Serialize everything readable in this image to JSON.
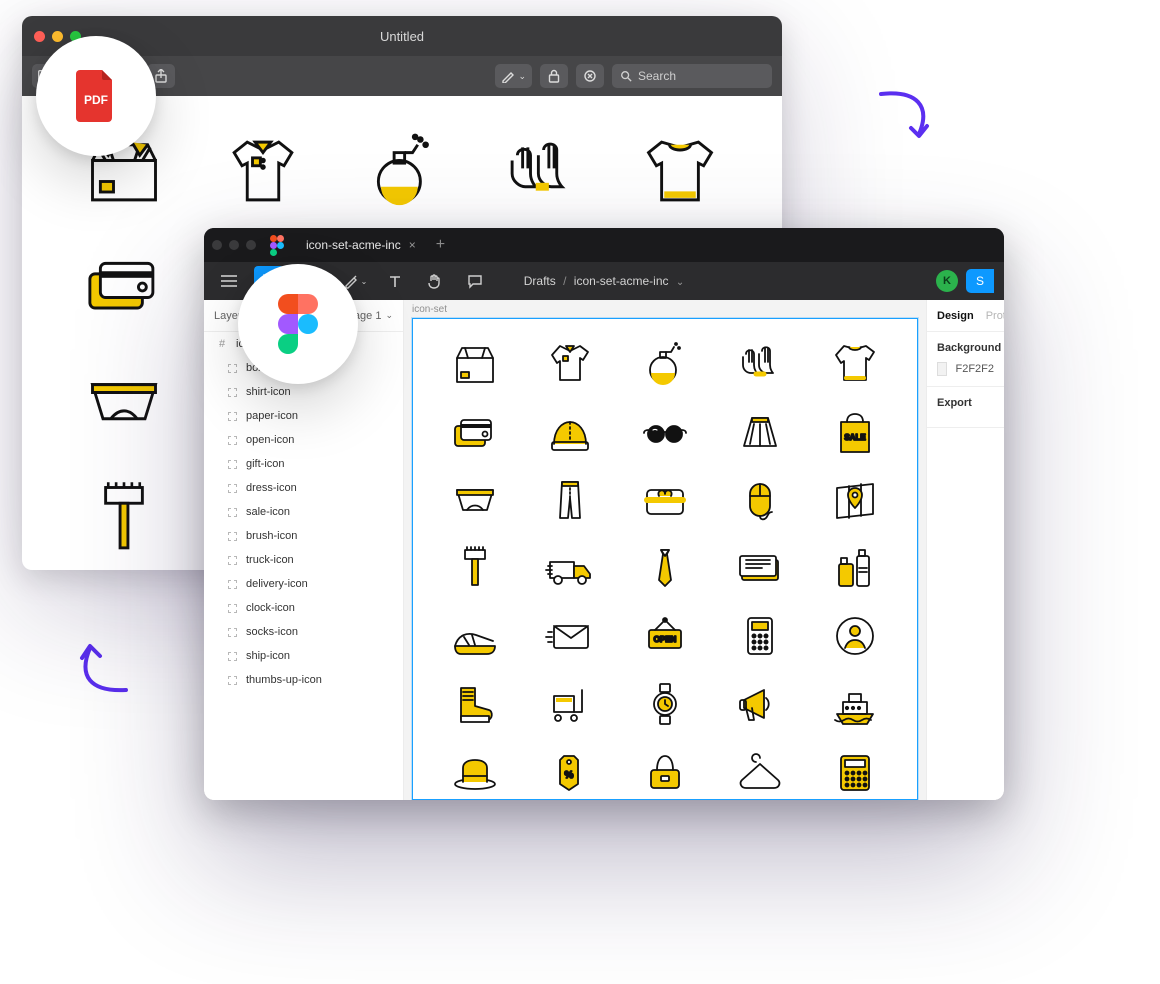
{
  "preview": {
    "title": "Untitled",
    "search_placeholder": "Search"
  },
  "pdf_badge": {
    "label": "PDF"
  },
  "figma": {
    "tab_title": "icon-set-acme-inc",
    "breadcrumb_root": "Drafts",
    "breadcrumb_file": "icon-set-acme-inc",
    "avatar_initial": "K",
    "share_label": "S",
    "left": {
      "layers_label": "Layers",
      "page_label": "Page 1",
      "frame_name": "icon-set",
      "items": [
        "box-icon",
        "shirt-icon",
        "paper-icon",
        "open-icon",
        "gift-icon",
        "dress-icon",
        "sale-icon",
        "brush-icon",
        "truck-icon",
        "delivery-icon",
        "clock-icon",
        "socks-icon",
        "ship-icon",
        "thumbs-up-icon"
      ]
    },
    "canvas": {
      "frame_label": "icon-set",
      "bag_text": "SALE",
      "open_sign_text": "OPEN"
    },
    "right": {
      "tab_design": "Design",
      "tab_proto": "Proto",
      "bg_title": "Background",
      "bg_value": "F2F2F2",
      "export_title": "Export"
    }
  }
}
